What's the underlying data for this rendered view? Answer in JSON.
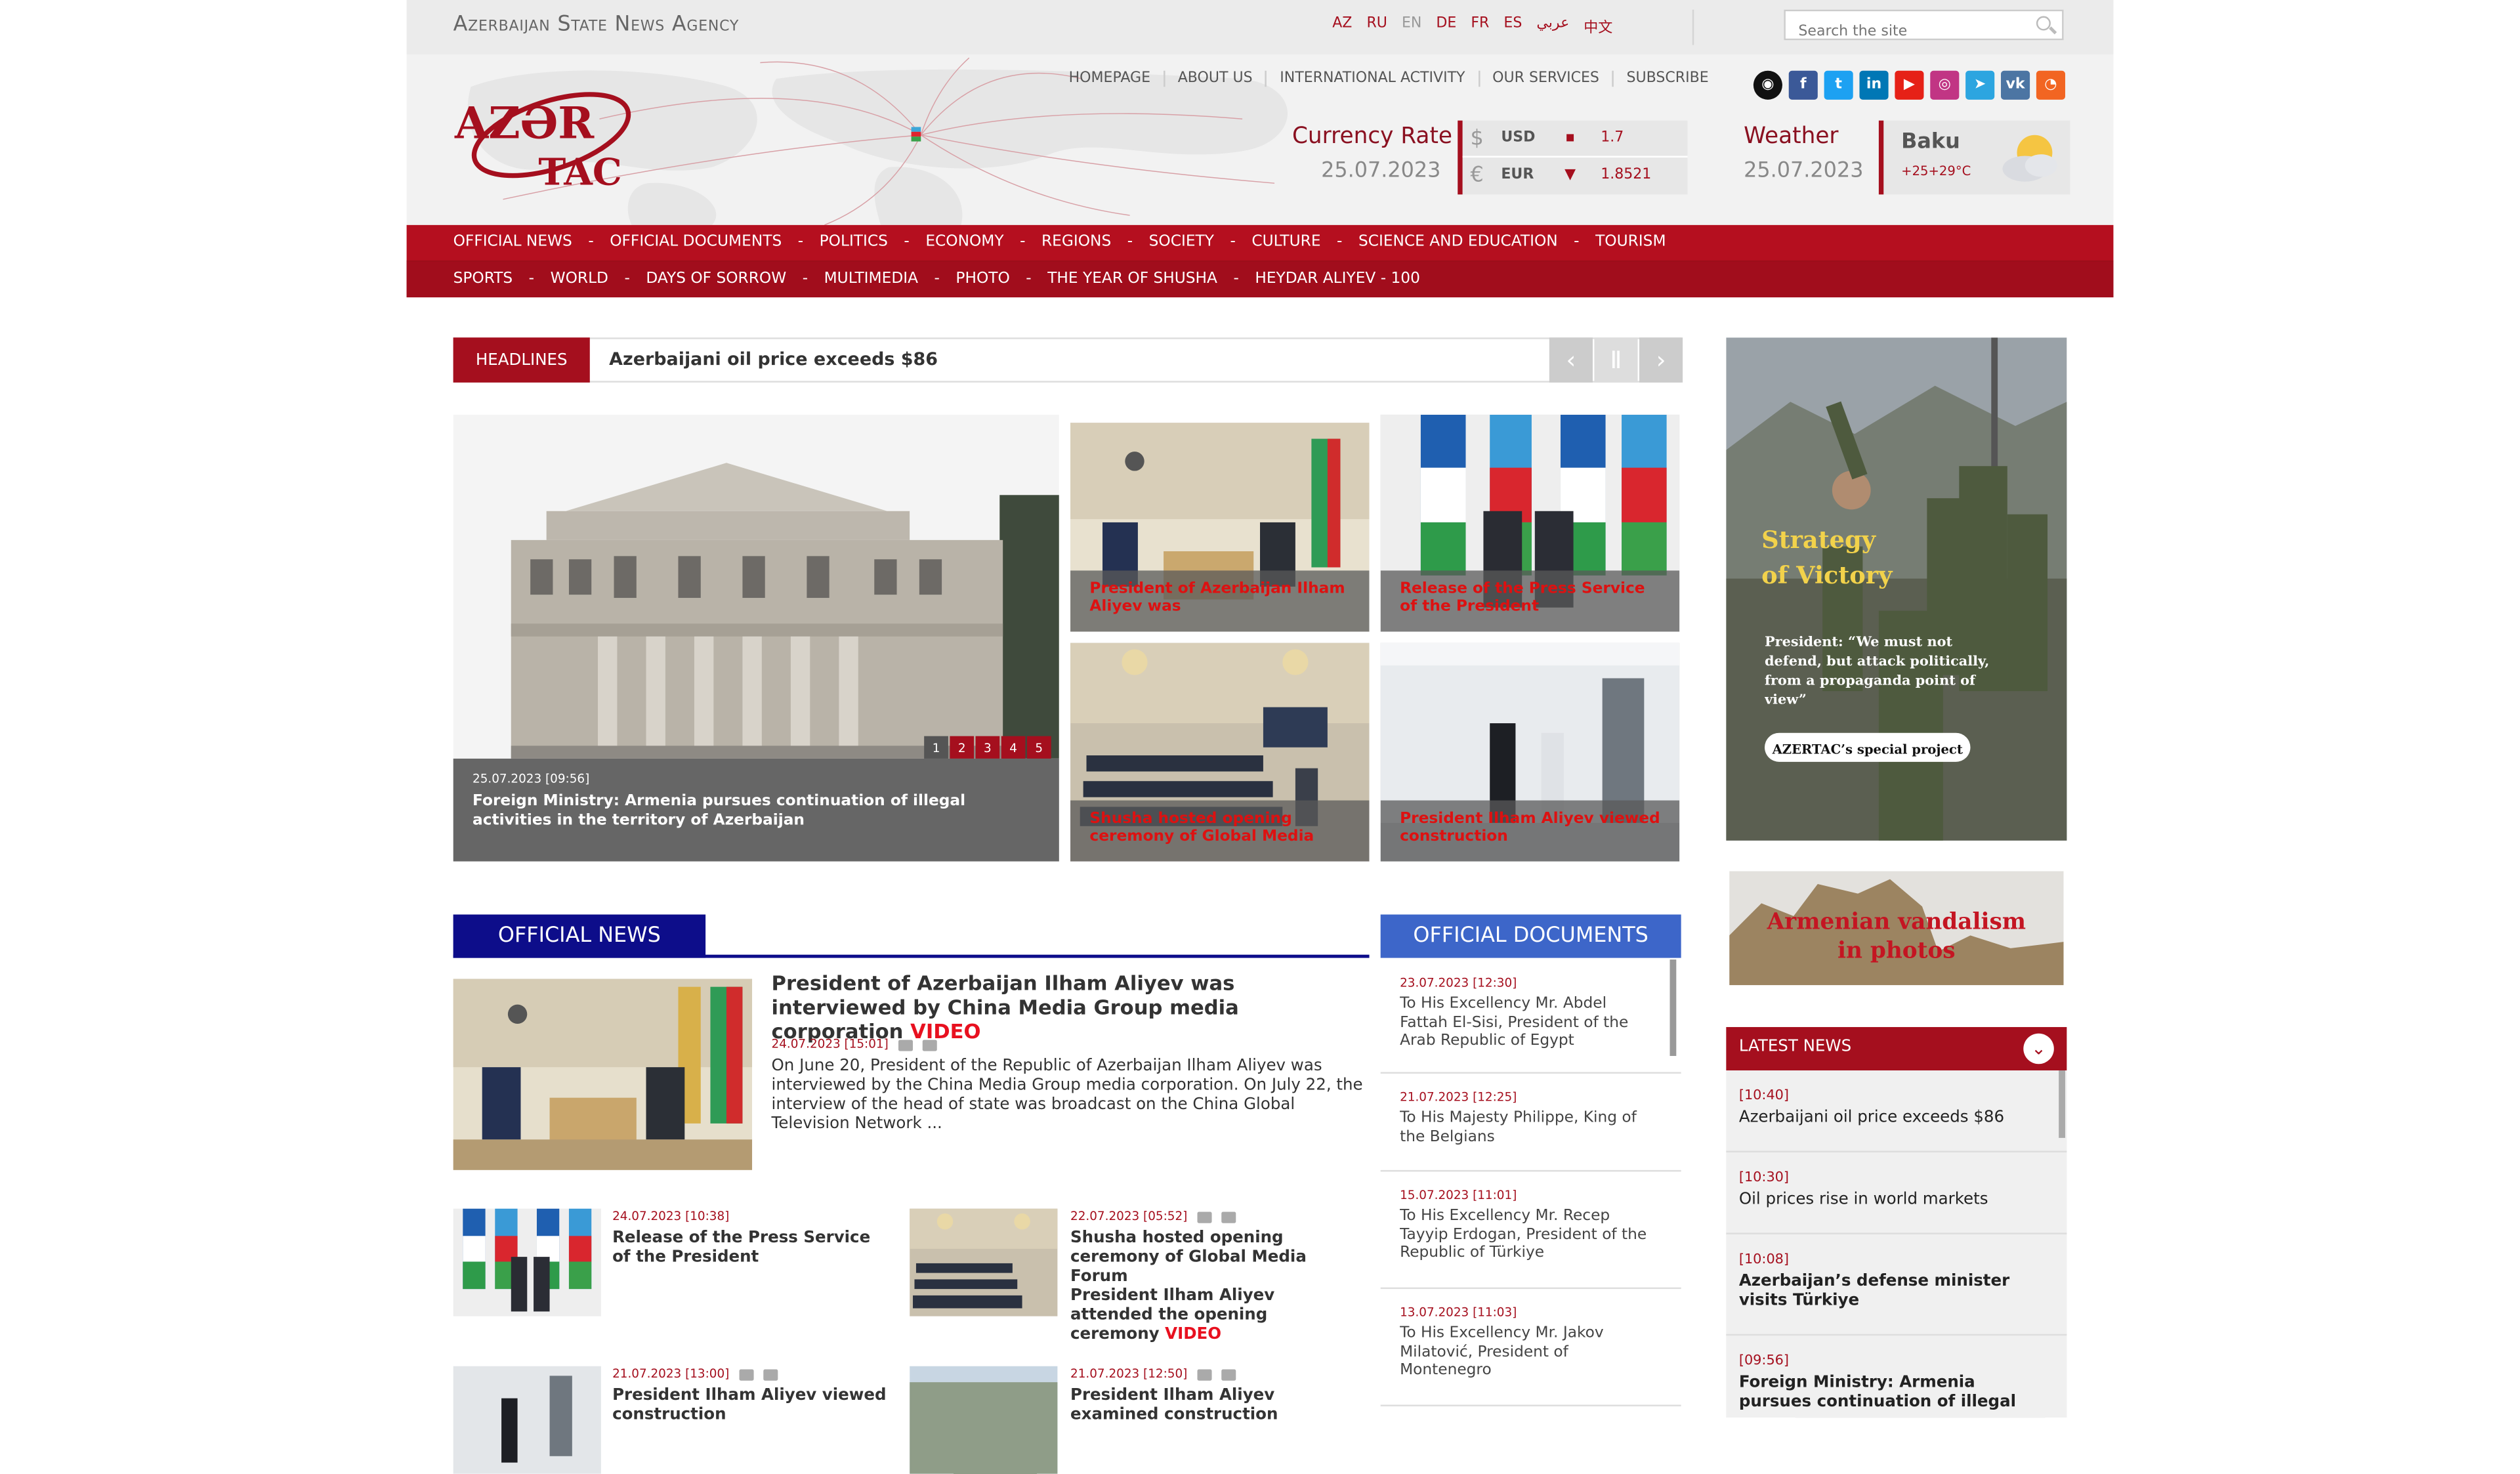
{
  "agency": "Azerbaijan State News Agency",
  "languages": [
    "AZ",
    "RU",
    "EN",
    "DE",
    "FR",
    "ES",
    "عربي",
    "中文"
  ],
  "active_language": "EN",
  "search": {
    "placeholder": "Search the site"
  },
  "top_nav": [
    "HOMEPAGE",
    "ABOUT US",
    "INTERNATIONAL ACTIVITY",
    "OUR SERVICES",
    "SUBSCRIBE"
  ],
  "logo": {
    "line1": "AZƏR",
    "line2": "TAC"
  },
  "currency": {
    "label": "Currency Rate",
    "date": "25.07.2023",
    "rows": [
      {
        "symbol": "$",
        "code": "USD",
        "trend": "▪",
        "value": "1.7"
      },
      {
        "symbol": "€",
        "code": "EUR",
        "trend": "▼",
        "value": "1.8521"
      }
    ]
  },
  "weather": {
    "label": "Weather",
    "date": "25.07.2023",
    "city": "Baku",
    "temp": "+25+29°C"
  },
  "main_nav": {
    "row1": [
      "OFFICIAL NEWS",
      "OFFICIAL DOCUMENTS",
      "POLITICS",
      "ECONOMY",
      "REGIONS",
      "SOCIETY",
      "CULTURE",
      "SCIENCE AND EDUCATION",
      "TOURISM"
    ],
    "row2": [
      "SPORTS",
      "WORLD",
      "DAYS OF SORROW",
      "MULTIMEDIA",
      "PHOTO",
      "THE YEAR OF SHUSHA",
      "HEYDAR ALIYEV - 100"
    ]
  },
  "headlines": {
    "label": "HEADLINES",
    "text": "Azerbaijani oil price exceeds $86"
  },
  "slider": {
    "date": "25.07.2023 [09:56]",
    "title": "Foreign Ministry: Armenia pursues continuation of illegal activities in the territory of Azerbaijan",
    "pages": [
      "1",
      "2",
      "3",
      "4",
      "5"
    ]
  },
  "thumbs": [
    "President of Azerbaijan Ilham Aliyev was",
    "Release of the Press Service of the President",
    "Shusha hosted opening ceremony of Global Media",
    "President Ilham Aliyev viewed construction"
  ],
  "official_news": {
    "label": "OFFICIAL NEWS",
    "main": {
      "title": "President of Azerbaijan Ilham Aliyev was interviewed by China Media Group media corporation",
      "video": "VIDEO",
      "date": "24.07.2023 [15:01]",
      "body": "On June 20, President of the Republic of Azerbaijan Ilham Aliyev was interviewed by the China Media Group media corporation. On July 22, the interview of the head of state was broadcast on the China Global Television Network ..."
    },
    "stories": [
      {
        "date": "24.07.2023 [10:38]",
        "title": "Release of the Press Service of the President"
      },
      {
        "date": "22.07.2023 [05:52]",
        "title": "Shusha hosted opening ceremony of Global Media Forum",
        "title2": "President Ilham Aliyev attended the opening ceremony",
        "video": "VIDEO"
      },
      {
        "date": "21.07.2023 [13:00]",
        "title": "President Ilham Aliyev viewed construction"
      },
      {
        "date": "21.07.2023 [12:50]",
        "title": "President Ilham Aliyev examined construction"
      }
    ]
  },
  "official_documents": {
    "label": "OFFICIAL DOCUMENTS",
    "items": [
      {
        "date": "23.07.2023 [12:30]",
        "title": "To His Excellency Mr. Abdel Fattah El-Sisi, President of the Arab Republic of Egypt"
      },
      {
        "date": "21.07.2023 [12:25]",
        "title": "To His Majesty Philippe, King of the Belgians"
      },
      {
        "date": "15.07.2023 [11:01]",
        "title": "To His Excellency Mr. Recep Tayyip Erdogan, President of the Republic of Türkiye"
      },
      {
        "date": "13.07.2023 [11:03]",
        "title": "To His Excellency Mr. Jakov Milatović, President of Montenegro"
      }
    ]
  },
  "ads": {
    "victory": {
      "title1": "Strategy",
      "title2": "of Victory",
      "quote": "President: “We must not defend, but attack politically, from a propaganda point of view”",
      "badge": "AZERTAC’s special project"
    },
    "vandal": {
      "line1": "Armenian vandalism",
      "line2": "in photos"
    }
  },
  "latest_news": {
    "label": "LATEST NEWS",
    "items": [
      {
        "time": "[10:40]",
        "title": "Azerbaijani oil price exceeds $86",
        "bold": false
      },
      {
        "time": "[10:30]",
        "title": "Oil prices rise in world markets",
        "bold": false
      },
      {
        "time": "[10:08]",
        "title": "Azerbaijan’s defense minister visits Türkiye",
        "bold": true
      },
      {
        "time": "[09:56]",
        "title": "Foreign Ministry: Armenia pursues continuation of illegal",
        "bold": true
      }
    ]
  },
  "colors": {
    "brand_red": "#a50f1e",
    "nav_red": "#b50f1f",
    "navy": "#0d0d8a",
    "doc_blue": "#3d66c9"
  }
}
